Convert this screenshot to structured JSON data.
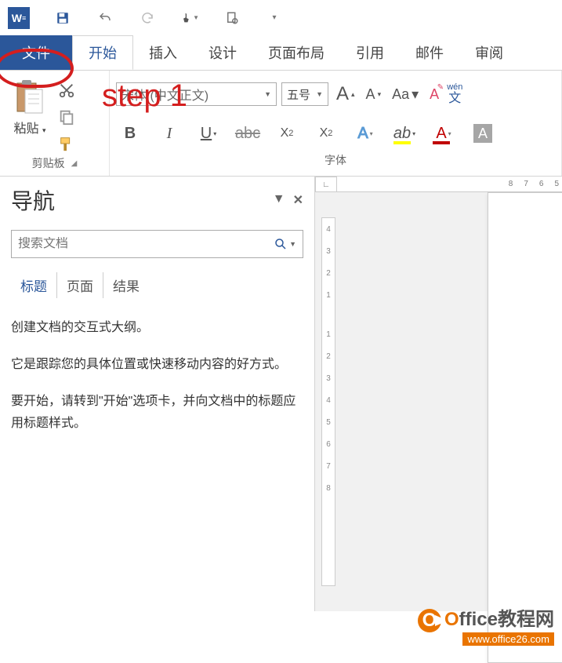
{
  "titlebar": {
    "app_letter": "W"
  },
  "tabs": {
    "file": "文件",
    "home": "开始",
    "insert": "插入",
    "design": "设计",
    "layout": "页面布局",
    "references": "引用",
    "mail": "邮件",
    "review": "审阅"
  },
  "annotation": {
    "step": "step 1"
  },
  "clipboard": {
    "paste": "粘贴",
    "label": "剪贴板"
  },
  "font": {
    "name": "宋体 (中文正文)",
    "size": "五号",
    "grow": "A",
    "shrink": "A",
    "case": "Aa",
    "clear_icon": "A",
    "pinyin_top": "wén",
    "pinyin_bottom": "文",
    "bold": "B",
    "italic": "I",
    "underline": "U",
    "strike": "abc",
    "sub": "X",
    "sub_s": "2",
    "sup": "X",
    "sup_s": "2",
    "effects": "A",
    "highlight": "ab",
    "color": "A",
    "shading": "A",
    "label": "字体"
  },
  "nav": {
    "title": "导航",
    "search_placeholder": "搜索文档",
    "tabs": {
      "headings": "标题",
      "pages": "页面",
      "results": "结果"
    },
    "body": {
      "p1": "创建文档的交互式大纲。",
      "p2": "它是跟踪您的具体位置或快速移动内容的好方式。",
      "p3": "要开始，请转到\"开始\"选项卡，并向文档中的标题应用标题样式。"
    }
  },
  "ruler": {
    "top": [
      "8",
      "7",
      "6",
      "5"
    ],
    "left_upper": [
      "4",
      "3",
      "2",
      "1"
    ],
    "left_lower": [
      "1",
      "2",
      "3",
      "4",
      "5",
      "6",
      "7",
      "8"
    ]
  },
  "watermark": {
    "brand": "Office教程网",
    "url": "www.office26.com"
  }
}
